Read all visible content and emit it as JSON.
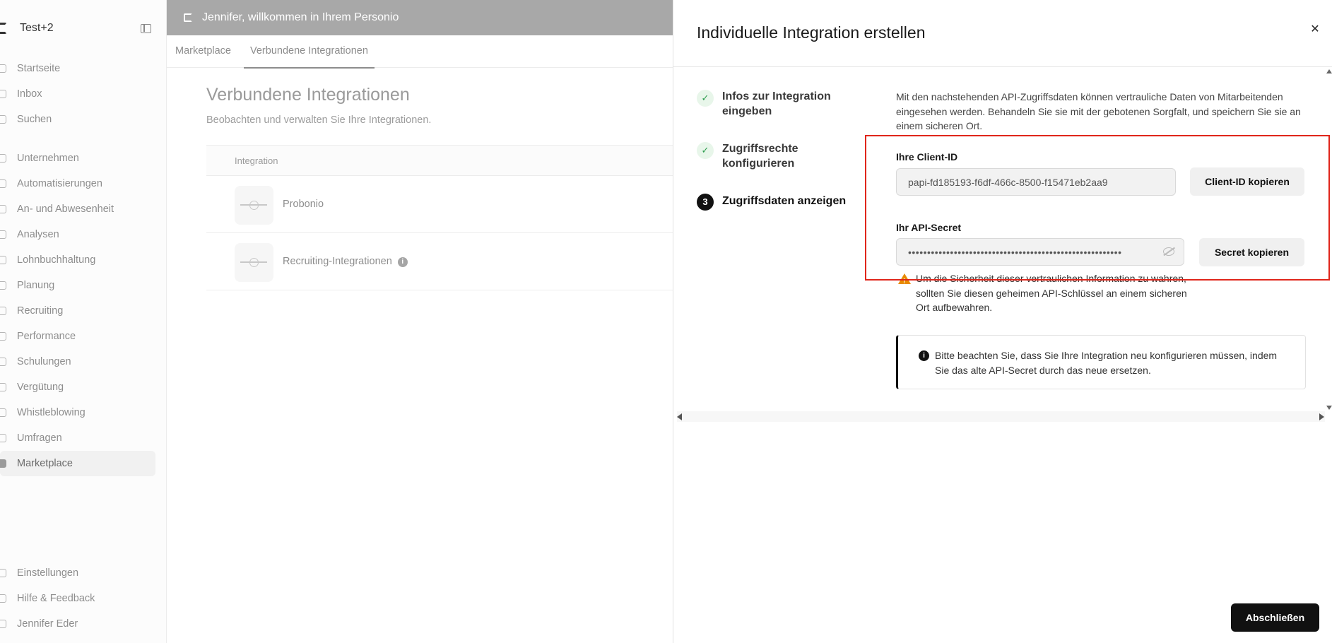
{
  "sidebar": {
    "title": "Test+2",
    "top_items": [
      {
        "label": "Startseite",
        "icon": "home-icon"
      },
      {
        "label": "Inbox",
        "icon": "inbox-icon"
      },
      {
        "label": "Suchen",
        "icon": "search-icon"
      }
    ],
    "main_items": [
      {
        "label": "Unternehmen",
        "icon": "company-icon"
      },
      {
        "label": "Automatisierungen",
        "icon": "bolt-icon"
      },
      {
        "label": "An- und Abwesenheit",
        "icon": "calendar-icon"
      },
      {
        "label": "Analysen",
        "icon": "chart-icon"
      },
      {
        "label": "Lohnbuchhaltung",
        "icon": "payroll-icon"
      },
      {
        "label": "Planung",
        "icon": "list-icon"
      },
      {
        "label": "Recruiting",
        "icon": "recruiting-icon"
      },
      {
        "label": "Performance",
        "icon": "performance-icon"
      },
      {
        "label": "Schulungen",
        "icon": "training-icon"
      },
      {
        "label": "Vergütung",
        "icon": "compensation-icon"
      },
      {
        "label": "Whistleblowing",
        "icon": "shield-icon"
      },
      {
        "label": "Umfragen",
        "icon": "survey-icon"
      },
      {
        "label": "Marketplace",
        "icon": "cube-icon",
        "active": true
      }
    ],
    "bottom_items": [
      {
        "label": "Einstellungen",
        "icon": "gear-icon"
      },
      {
        "label": "Hilfe & Feedback",
        "icon": "help-icon"
      },
      {
        "label": "Jennifer Eder",
        "icon": "user-icon"
      }
    ]
  },
  "banner": {
    "text": "Jennifer, willkommen in Ihrem Personio"
  },
  "tabs": {
    "marketplace": "Marketplace",
    "connected": "Verbundene Integrationen"
  },
  "main": {
    "title": "Verbundene Integrationen",
    "subtitle": "Beobachten und verwalten Sie Ihre Integrationen.",
    "table_header": "Integration",
    "rows": [
      {
        "name": "Probonio"
      },
      {
        "name": "Recruiting-Integrationen"
      }
    ]
  },
  "dialog": {
    "title": "Individuelle Integration erstellen",
    "close": "✕",
    "steps": [
      {
        "label": "Infos zur Integration eingeben",
        "state": "done"
      },
      {
        "label": "Zugriffsrechte konfigurieren",
        "state": "done"
      },
      {
        "label": "Zugriffsdaten anzeigen",
        "state": "current",
        "number": "3"
      }
    ],
    "intro": "Mit den nachstehenden API-Zugriffsdaten können vertrauliche Daten von Mitarbeitenden eingesehen werden. Behandeln Sie sie mit der gebotenen Sorgfalt, und speichern Sie sie an einem sicheren Ort.",
    "client_id_label": "Ihre Client-ID",
    "client_id_value": "papi-fd185193-f6df-466c-8500-f15471eb2aa9",
    "copy_client_id": "Client-ID kopieren",
    "secret_label": "Ihr API-Secret",
    "secret_value": "••••••••••••••••••••••••••••••••••••••••••••••••••••••••",
    "copy_secret": "Secret kopieren",
    "warning": "Um die Sicherheit dieser vertraulichen Information zu wahren, sollten Sie diesen geheimen API-Schlüssel an einem sicheren Ort aufbewahren.",
    "note": "Bitte beachten Sie, dass Sie Ihre Integration neu konfigurieren müssen, indem Sie das alte API-Secret durch das neue ersetzen.",
    "finish": "Abschließen"
  },
  "colors": {
    "highlight": "#e0261b",
    "primary": "#111111",
    "success": "#2d9c4e",
    "warning": "#e88a00"
  }
}
